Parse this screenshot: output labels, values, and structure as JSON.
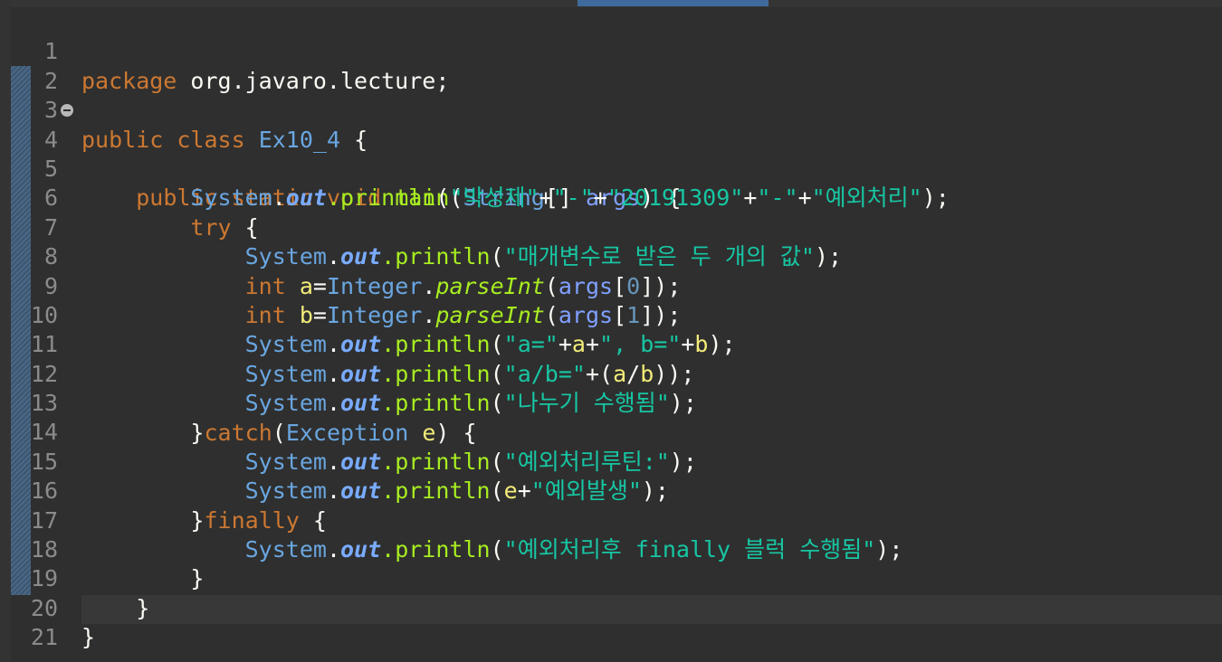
{
  "editor": {
    "language": "java",
    "colors": {
      "background": "#2f2f2f",
      "keyword": "#cc7832",
      "type": "#6aa6e0",
      "static_field": "#79abff",
      "method": "#a7ec21",
      "string": "#17c6a3",
      "local_variable": "#f3ec79",
      "parameter": "#80a0ff",
      "line_number": "#8b8b8b"
    },
    "fold_icon": "collapse-minus-icon",
    "line_numbers": [
      "1",
      "2",
      "3",
      "4",
      "5",
      "6",
      "7",
      "8",
      "9",
      "10",
      "11",
      "12",
      "13",
      "14",
      "15",
      "16",
      "17",
      "18",
      "19",
      "20",
      "21"
    ]
  },
  "code": {
    "l1": {
      "kw": "package",
      "t1": " org.javaro.lecture;"
    },
    "l3": {
      "kw1": "public",
      "kw2": "class",
      "cls": "Ex10_4",
      "t1": " {"
    },
    "l4": {
      "kw1": "public",
      "kw2": "static",
      "kw3": "void",
      "mth": "main",
      "t1": "(",
      "type": "String",
      "t2": "[] ",
      "param": "args",
      "t3": ") {"
    },
    "l5": {
      "cls": "System",
      "dot": ".",
      "fld": "out",
      "mth": ".println",
      "t1": "(",
      "s1": "\"박성제\"",
      "p1": "+",
      "s2": "\"-\"",
      "p2": "+",
      "s3": "\"20191309\"",
      "p3": "+",
      "s4": "\"-\"",
      "p4": "+",
      "s5": "\"예외처리\"",
      "t2": ");"
    },
    "l6": {
      "kw": "try",
      "t1": " {"
    },
    "l7": {
      "cls": "System",
      "dot": ".",
      "fld": "out",
      "mth": ".println",
      "t1": "(",
      "s1": "\"매개변수로 받은 두 개의 값\"",
      "t2": ");"
    },
    "l8": {
      "kw": "int",
      "var": "a",
      "t1": "=",
      "cls": "Integer",
      "dot": ".",
      "smth": "parseInt",
      "t2": "(",
      "param": "args",
      "t3": "[",
      "num": "0",
      "t4": "]);"
    },
    "l9": {
      "kw": "int",
      "var": "b",
      "t1": "=",
      "cls": "Integer",
      "dot": ".",
      "smth": "parseInt",
      "t2": "(",
      "param": "args",
      "t3": "[",
      "num": "1",
      "t4": "]);"
    },
    "l10": {
      "cls": "System",
      "dot": ".",
      "fld": "out",
      "mth": ".println",
      "t1": "(",
      "s1": "\"a=\"",
      "p1": "+",
      "v1": "a",
      "p2": "+",
      "s2": "\", b=\"",
      "p3": "+",
      "v2": "b",
      "t2": ");"
    },
    "l11": {
      "cls": "System",
      "dot": ".",
      "fld": "out",
      "mth": ".println",
      "t1": "(",
      "s1": "\"a/b=\"",
      "p1": "+(",
      "v1": "a",
      "p2": "/",
      "v2": "b",
      "t2": "));"
    },
    "l12": {
      "cls": "System",
      "dot": ".",
      "fld": "out",
      "mth": ".println",
      "t1": "(",
      "s1": "\"나누기 수행됨\"",
      "t2": ");"
    },
    "l13": {
      "t0": "}",
      "kw": "catch",
      "t1": "(",
      "cls": "Exception",
      "t2": " ",
      "var": "e",
      "t3": ") {"
    },
    "l14": {
      "cls": "System",
      "dot": ".",
      "fld": "out",
      "mth": ".println",
      "t1": "(",
      "s1": "\"예외처리루틴:\"",
      "t2": ");"
    },
    "l15": {
      "cls": "System",
      "dot": ".",
      "fld": "out",
      "mth": ".println",
      "t1": "(",
      "v1": "e",
      "p1": "+",
      "s1": "\"예외발생\"",
      "t2": ");"
    },
    "l16": {
      "t0": "}",
      "kw": "finally",
      "t1": " {"
    },
    "l17": {
      "cls": "System",
      "dot": ".",
      "fld": "out",
      "mth": ".println",
      "t1": "(",
      "s1": "\"예외처리후 finally 블럭 수행됨\"",
      "t2": ");"
    },
    "l18": {
      "t1": "}"
    },
    "l19": {
      "t1": "}"
    },
    "l20": {
      "t1": "}"
    }
  }
}
